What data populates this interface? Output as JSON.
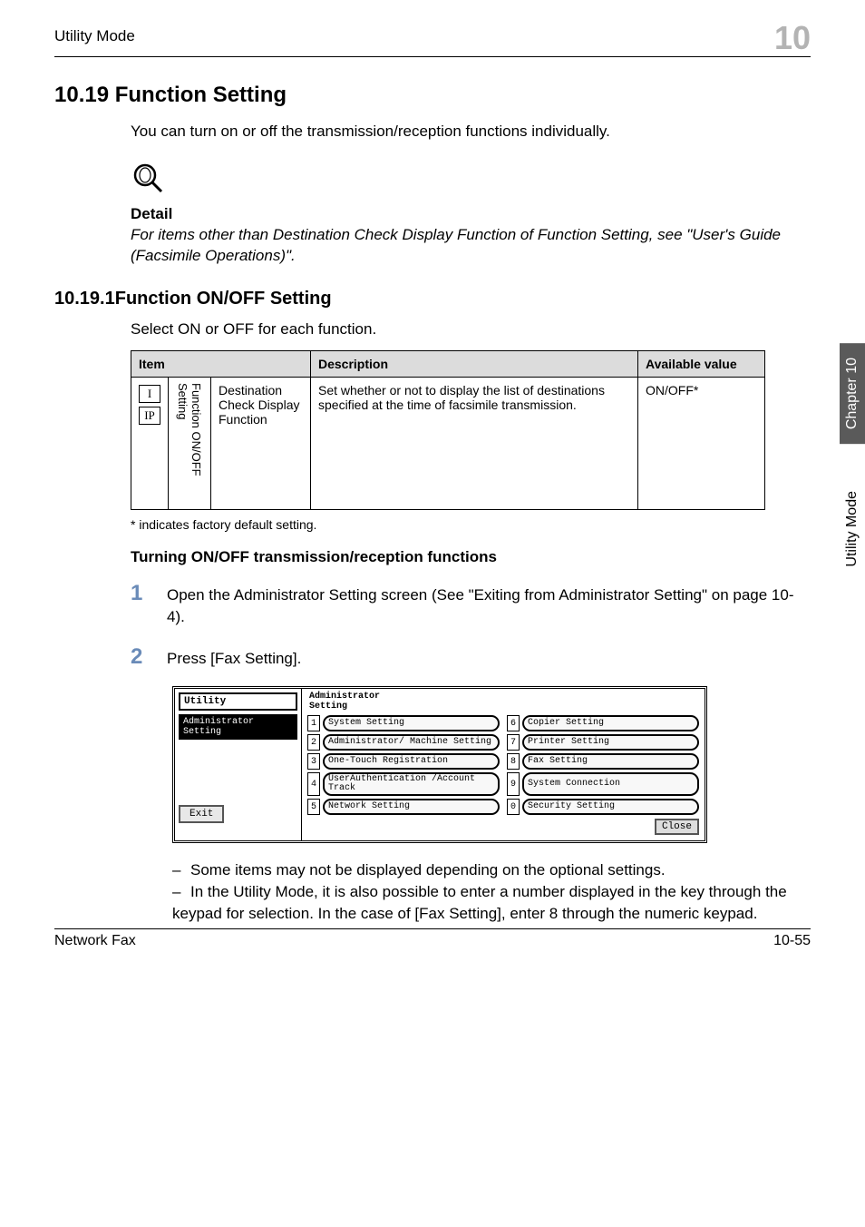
{
  "header": {
    "left": "Utility Mode",
    "chapter_number": "10"
  },
  "section": {
    "title": "10.19 Function Setting",
    "intro": "You can turn on or off the transmission/reception functions individually.",
    "detail_label": "Detail",
    "detail_text": "For items other than Destination Check Display Function of Function Setting, see \"User's Guide (Facsimile Operations)\"."
  },
  "subsection": {
    "title": "10.19.1Function ON/OFF Setting",
    "intro": "Select ON or OFF for each function."
  },
  "table": {
    "headers": {
      "item": "Item",
      "description": "Description",
      "available": "Available value"
    },
    "row": {
      "ip_i": "I",
      "ip_ip": "IP",
      "vert": "Function ON/OFF Setting",
      "item_label": "Destination Check Display Function",
      "description": "Set whether or not to display the list of destinations specified at the time of facsimile transmission.",
      "available": "ON/OFF*"
    }
  },
  "asterisk_note": "* indicates factory default setting.",
  "turning_heading": "Turning ON/OFF transmission/reception functions",
  "steps": {
    "s1_num": "1",
    "s1_text": "Open the Administrator Setting screen (See \"Exiting from Administrator Setting\" on page 10-4).",
    "s2_num": "2",
    "s2_text": "Press [Fax Setting]."
  },
  "device_screen": {
    "sidebar_header": "Utility",
    "sidebar_selected": "Administrator Setting",
    "sidebar_exit": "Exit",
    "title_line1": "Administrator",
    "title_line2": "Setting",
    "menu": [
      {
        "num": "1",
        "label": "System Setting"
      },
      {
        "num": "6",
        "label": "Copier Setting"
      },
      {
        "num": "2",
        "label": "Administrator/\nMachine Setting"
      },
      {
        "num": "7",
        "label": "Printer Setting"
      },
      {
        "num": "3",
        "label": "One-Touch\nRegistration"
      },
      {
        "num": "8",
        "label": "Fax Setting"
      },
      {
        "num": "4",
        "label": "UserAuthentication\n/Account Track"
      },
      {
        "num": "9",
        "label": "System Connection"
      },
      {
        "num": "5",
        "label": "Network Setting"
      },
      {
        "num": "0",
        "label": "Security Setting"
      }
    ],
    "close": "Close"
  },
  "bullets": {
    "b1": "Some items may not be displayed depending on the optional settings.",
    "b2": "In the Utility Mode, it is also possible to enter a number displayed in the key through the keypad for selection. In the case of [Fax Setting], enter 8 through the numeric keypad."
  },
  "footer": {
    "left": "Network Fax",
    "right": "10-55"
  },
  "side_tabs": {
    "dark": "Chapter 10",
    "light": "Utility Mode"
  }
}
